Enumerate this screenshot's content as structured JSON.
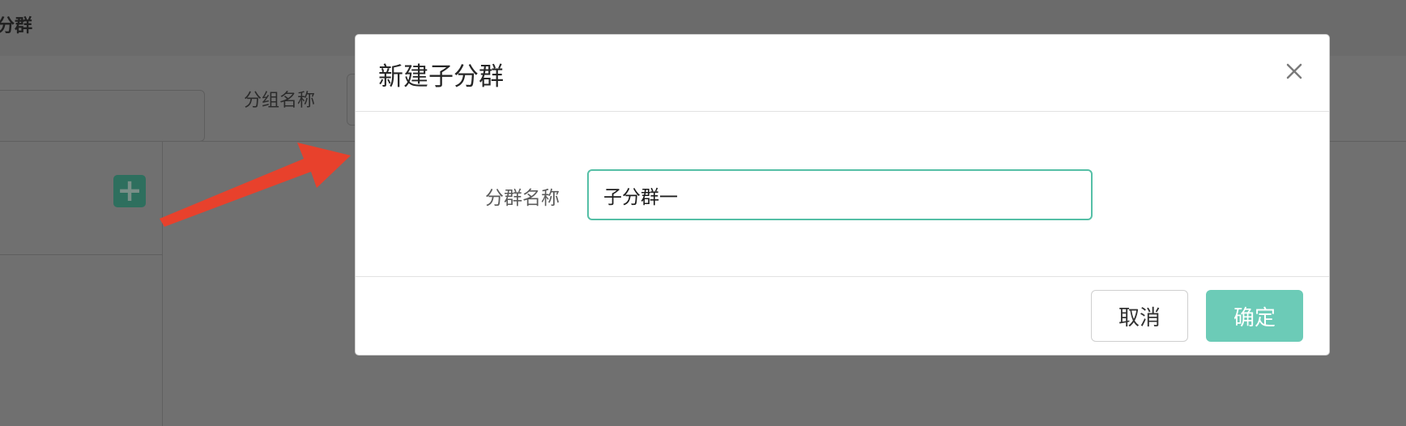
{
  "background": {
    "header_title": "分群",
    "group_label": "分组名称",
    "add_button_glyph": "+",
    "add_icon": "plus-icon"
  },
  "modal": {
    "title": "新建子分群",
    "close_icon": "close-icon",
    "form": {
      "label": "分群名称",
      "value": "子分群一"
    },
    "buttons": {
      "cancel": "取消",
      "confirm": "确定"
    }
  },
  "colors": {
    "accent": "#55bfa6",
    "confirm_button": "#6ccbb7",
    "arrow": "#e8412c",
    "overlay": "#707070"
  }
}
